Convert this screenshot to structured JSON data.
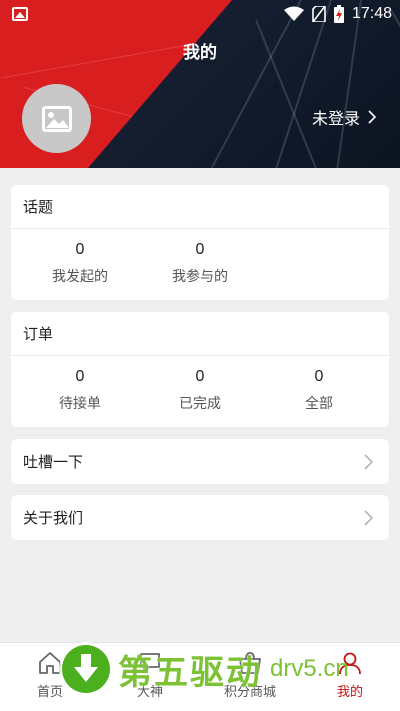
{
  "status_bar": {
    "time": "17:48"
  },
  "header": {
    "title": "我的",
    "login_label": "未登录"
  },
  "topics": {
    "title": "话题",
    "items": [
      {
        "value": "0",
        "label": "我发起的"
      },
      {
        "value": "0",
        "label": "我参与的"
      }
    ]
  },
  "orders": {
    "title": "订单",
    "items": [
      {
        "value": "0",
        "label": "待接单"
      },
      {
        "value": "0",
        "label": "已完成"
      },
      {
        "value": "0",
        "label": "全部"
      }
    ]
  },
  "menu": {
    "feedback_label": "吐槽一下",
    "about_label": "关于我们"
  },
  "bottom_nav": {
    "items": [
      {
        "label": "首页",
        "icon": "home-icon"
      },
      {
        "label": "大神",
        "icon": "chat-icon"
      },
      {
        "label": "积分商城",
        "icon": "shop-icon"
      },
      {
        "label": "我的",
        "icon": "user-icon"
      }
    ],
    "active_index": 3
  },
  "watermark": {
    "text": "第五驱动",
    "site": "drv5.cn"
  },
  "colors": {
    "accent": "#d81e1e",
    "active": "#c81414",
    "background": "#efefef"
  }
}
